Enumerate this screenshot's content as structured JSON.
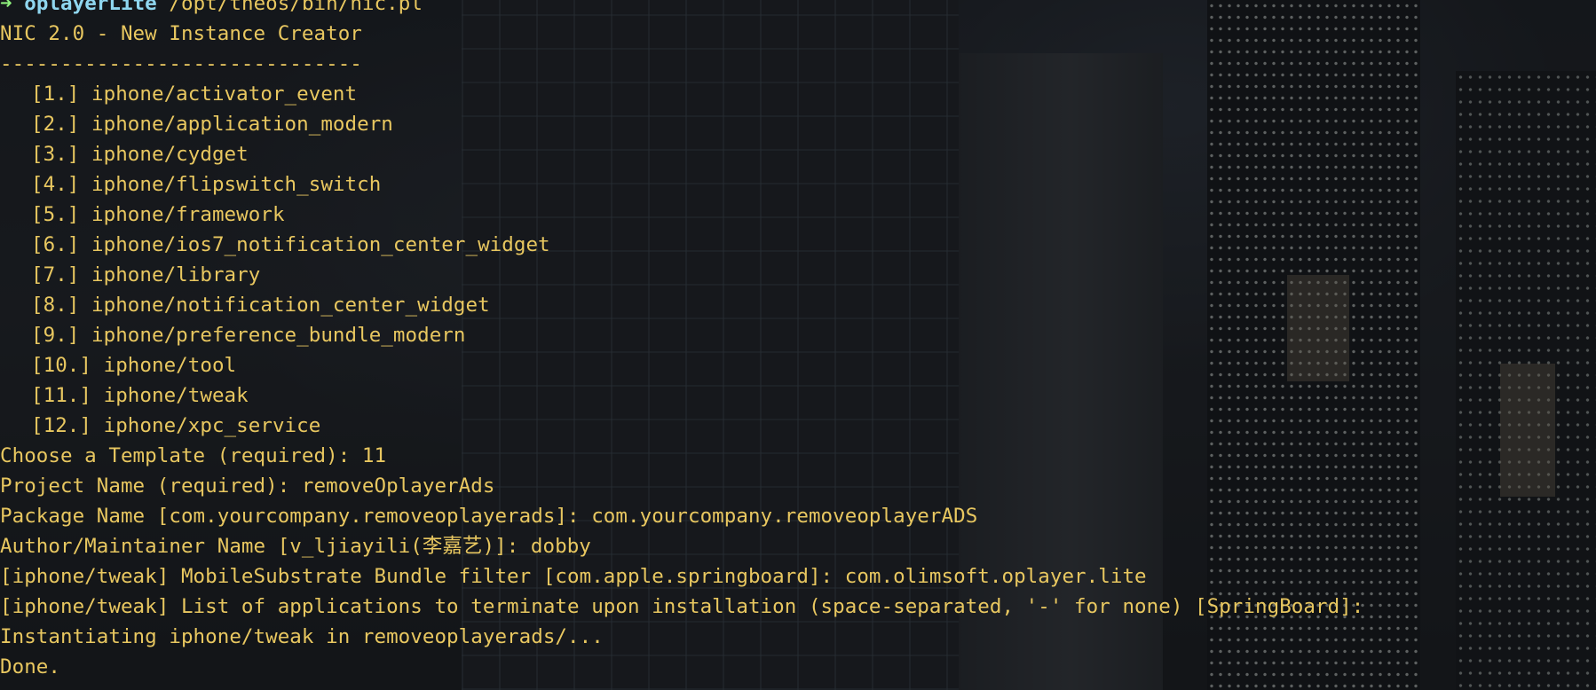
{
  "prompt": {
    "arrow": "➜",
    "directory": "oplayerLite",
    "command": "/opt/theos/bin/nic.pl"
  },
  "header": {
    "title": "NIC 2.0 - New Instance Creator",
    "separator": "------------------------------"
  },
  "templates": [
    {
      "index": "[1.]",
      "name": "iphone/activator_event"
    },
    {
      "index": "[2.]",
      "name": "iphone/application_modern"
    },
    {
      "index": "[3.]",
      "name": "iphone/cydget"
    },
    {
      "index": "[4.]",
      "name": "iphone/flipswitch_switch"
    },
    {
      "index": "[5.]",
      "name": "iphone/framework"
    },
    {
      "index": "[6.]",
      "name": "iphone/ios7_notification_center_widget"
    },
    {
      "index": "[7.]",
      "name": "iphone/library"
    },
    {
      "index": "[8.]",
      "name": "iphone/notification_center_widget"
    },
    {
      "index": "[9.]",
      "name": "iphone/preference_bundle_modern"
    },
    {
      "index": "[10.]",
      "name": "iphone/tool"
    },
    {
      "index": "[11.]",
      "name": "iphone/tweak"
    },
    {
      "index": "[12.]",
      "name": "iphone/xpc_service"
    }
  ],
  "output": [
    "Choose a Template (required): 11",
    "Project Name (required): removeOplayerAds",
    "Package Name [com.yourcompany.removeoplayerads]: com.yourcompany.removeoplayerADS",
    "Author/Maintainer Name [v_ljiayili(李嘉艺)]: dobby",
    "[iphone/tweak] MobileSubstrate Bundle filter [com.apple.springboard]: com.olimsoft.oplayer.lite",
    "[iphone/tweak] List of applications to terminate upon installation (space-separated, '-' for none) [SpringBoard]:",
    "Instantiating iphone/tweak in removeoplayerads/...",
    "Done."
  ],
  "colors": {
    "text": "#e8c760",
    "prompt_arrow": "#8ef07c",
    "prompt_directory": "#8fd6ef",
    "background": "#1b1d21"
  }
}
